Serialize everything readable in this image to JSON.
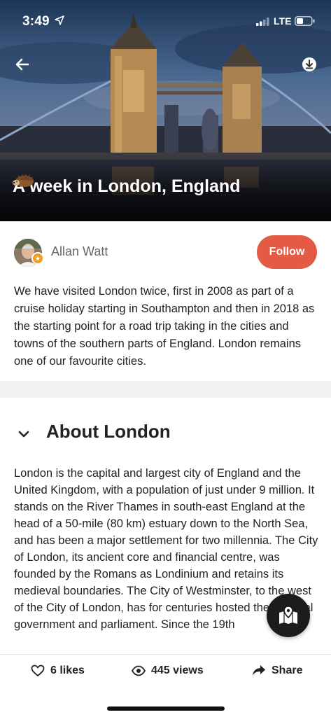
{
  "status_bar": {
    "time": "3:49",
    "network": "LTE",
    "icons": [
      "location-arrow-icon",
      "signal-icon",
      "battery-icon"
    ]
  },
  "hero": {
    "title": "A week in London, England",
    "title_emoji": "hedgehog-icon",
    "background": "tower-bridge-photo",
    "back_icon": "back-arrow-icon",
    "download_icon": "download-icon"
  },
  "author": {
    "name": "Allan Watt",
    "badge_icon": "star-badge-icon",
    "follow_label": "Follow"
  },
  "intro": "We have visited London twice, first in 2008 as part of a cruise holiday starting in Southampton and then in 2018 as the starting point for a road trip taking in the cities and towns of the southern parts of England. London remains one of our favourite cities.",
  "section": {
    "title": "About London",
    "chevron_icon": "chevron-down-icon",
    "body": "London is the capital and largest city of England and the United Kingdom, with a population of just under 9 million. It stands on the River Thames in south-east England at the head of a 50-mile (80 km) estuary down to the North Sea, and has been a major settlement for two millennia. The City of London, its ancient core and financial centre, was founded by the Romans as Londinium and retains its medieval boundaries. The City of Westminster, to the west of the City of London, has for centuries hosted the national government and parliament. Since the 19th"
  },
  "map_button_icon": "map-marker-icon",
  "bottom_bar": {
    "likes": "6 likes",
    "views": "445 views",
    "share": "Share"
  },
  "colors": {
    "accent": "#e35b45",
    "fab": "#1c1c1c",
    "badge": "#f0a020"
  }
}
